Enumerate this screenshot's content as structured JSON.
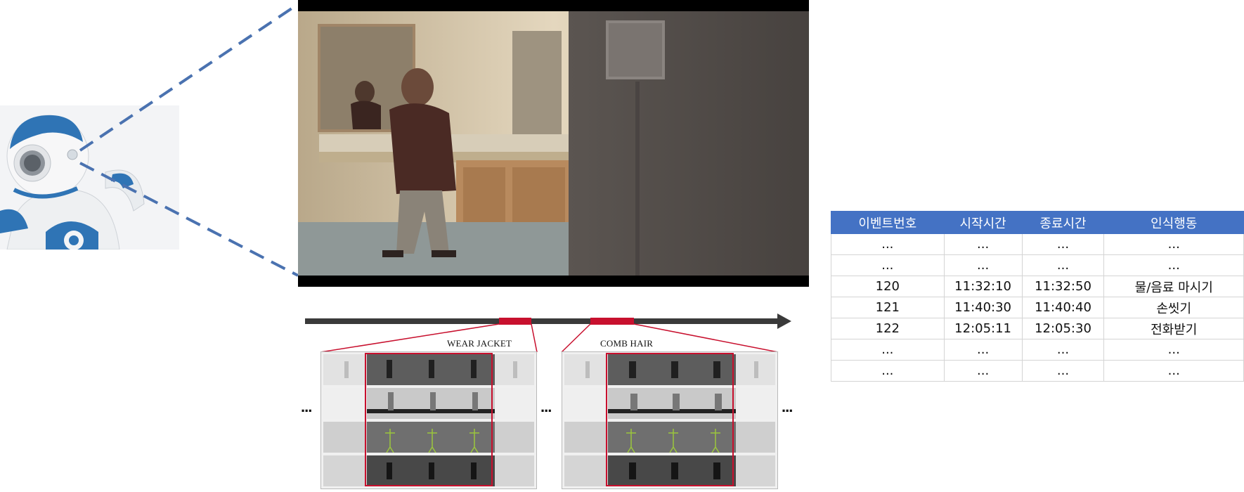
{
  "panels": [
    {
      "label": "WEAR JACKET"
    },
    {
      "label": "COMB HAIR"
    }
  ],
  "ellipsis": "...",
  "table": {
    "headers": [
      "이벤트번호",
      "시작시간",
      "종료시간",
      "인식행동"
    ],
    "rows": [
      [
        "...",
        "...",
        "...",
        "..."
      ],
      [
        "...",
        "...",
        "...",
        "..."
      ],
      [
        "120",
        "11:32:10",
        "11:32:50",
        "물/음료 마시기"
      ],
      [
        "121",
        "11:40:30",
        "11:40:40",
        "손씻기"
      ],
      [
        "122",
        "12:05:11",
        "12:05:30",
        "전화받기"
      ],
      [
        "...",
        "...",
        "...",
        "..."
      ],
      [
        "...",
        "...",
        "...",
        "..."
      ]
    ]
  },
  "colors": {
    "header_blue": "#4472c4",
    "dash_blue": "#4a72b0",
    "highlight_red": "#c8102e",
    "timeline_gray": "#3a3a3a"
  }
}
